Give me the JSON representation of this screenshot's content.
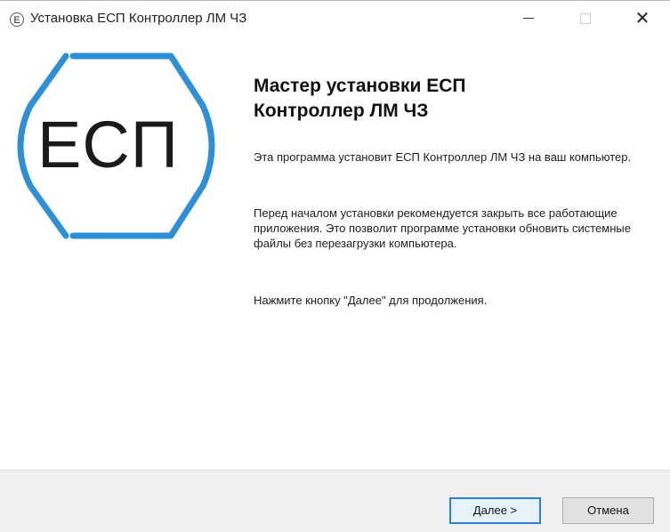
{
  "window": {
    "title": "Установка ЕСП Контроллер ЛМ ЧЗ",
    "icon_letter": "Е",
    "minimize_icon": "minimize-icon",
    "maximize_icon": "maximize-icon",
    "close_label": "✕"
  },
  "logo": {
    "text": "ЕСП",
    "accent_color": "#2e8fd9"
  },
  "wizard": {
    "heading_line1": "Мастер установки ЕСП",
    "heading_line2": "Контроллер ЛМ ЧЗ",
    "paragraph1": "Эта программа установит ЕСП Контроллер ЛМ ЧЗ на ваш компьютер.",
    "paragraph2": "Перед началом установки рекомендуется закрыть все работающие приложения. Это позволит программе установки обновить системные файлы без перезагрузки компьютера.",
    "paragraph3": "Нажмите кнопку \"Далее\" для продолжения."
  },
  "buttons": {
    "next_label": "Далее >",
    "cancel_label": "Отмена"
  }
}
